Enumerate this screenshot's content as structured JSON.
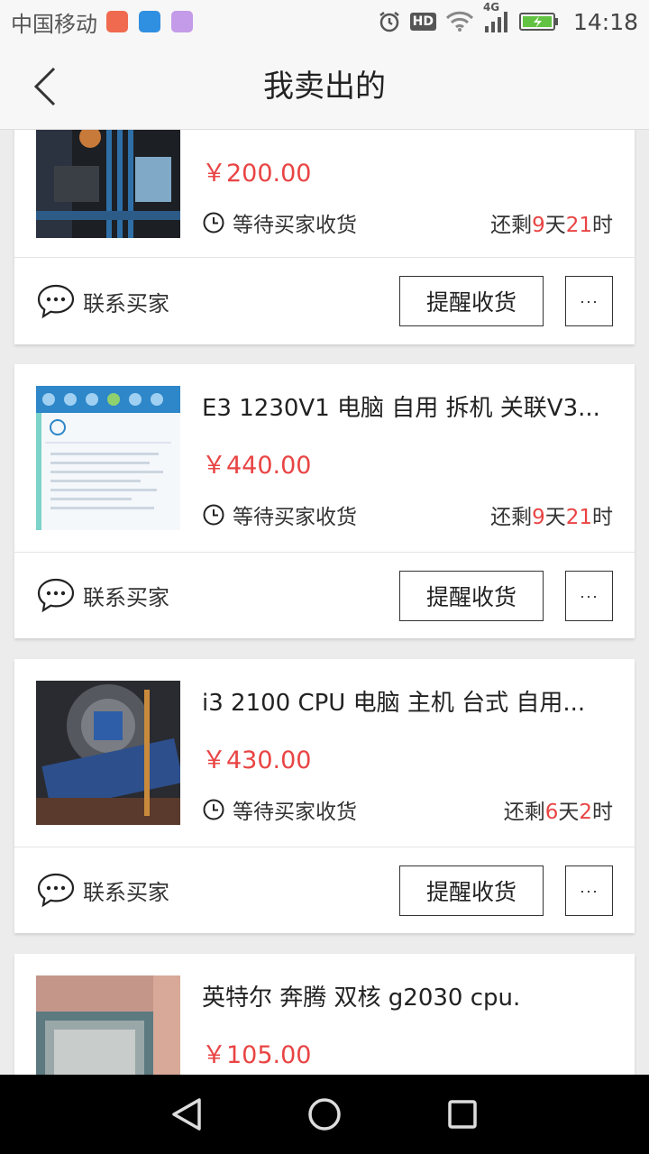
{
  "status_bar": {
    "carrier": "中国移动",
    "network": "4G",
    "hd": "HD",
    "time": "14:18",
    "apps": [
      {
        "icon": "app-orange-icon",
        "color": "#f06a4f"
      },
      {
        "icon": "shield-app-icon",
        "color": "#2f8fe0"
      },
      {
        "icon": "gallery-app-icon",
        "color": "#c39be8"
      }
    ]
  },
  "header": {
    "title": "我卖出的"
  },
  "colors": {
    "accent_red": "#e94444",
    "text_dark": "#222222"
  },
  "orders": [
    {
      "title": "",
      "price": "￥200.00",
      "status": "等待买家收货",
      "remain_prefix": "还剩",
      "days": "9",
      "day_unit": "天",
      "hours": "21",
      "hour_unit": "时",
      "contact": "联系买家",
      "remind": "提醒收货",
      "more": "···"
    },
    {
      "title": "E3 1230V1 电脑 自用 拆机 关联V3...",
      "price": "￥440.00",
      "status": "等待买家收货",
      "remain_prefix": "还剩",
      "days": "9",
      "day_unit": "天",
      "hours": "21",
      "hour_unit": "时",
      "contact": "联系买家",
      "remind": "提醒收货",
      "more": "···"
    },
    {
      "title": "i3 2100 CPU  电脑 主机 台式 自用...",
      "price": "￥430.00",
      "status": "等待买家收货",
      "remain_prefix": "还剩",
      "days": "6",
      "day_unit": "天",
      "hours": "2",
      "hour_unit": "时",
      "contact": "联系买家",
      "remind": "提醒收货",
      "more": "···"
    },
    {
      "title": "英特尔 奔腾 双核 g2030  cpu.",
      "price": "￥105.00"
    }
  ]
}
